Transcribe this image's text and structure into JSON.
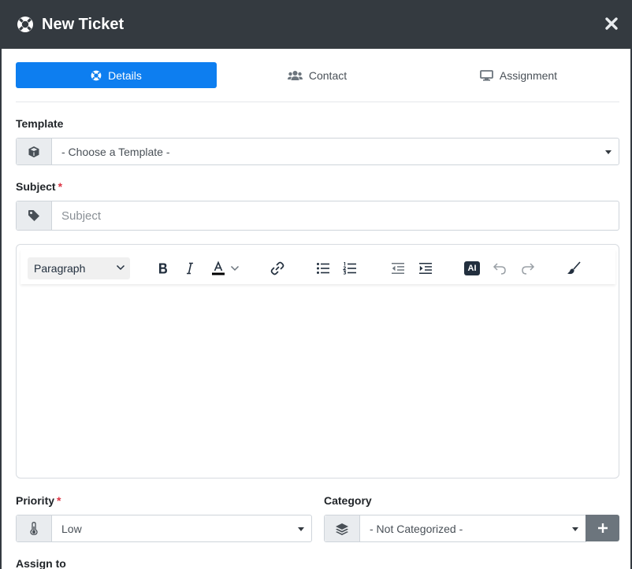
{
  "header": {
    "title": "New Ticket"
  },
  "tabs": [
    {
      "label": "Details",
      "active": true
    },
    {
      "label": "Contact",
      "active": false
    },
    {
      "label": "Assignment",
      "active": false
    }
  ],
  "template": {
    "label": "Template",
    "value": "- Choose a Template -"
  },
  "subject": {
    "label": "Subject",
    "required_mark": "*",
    "placeholder": "Subject"
  },
  "editor": {
    "block_format": "Paragraph",
    "ai_label": "AI"
  },
  "priority": {
    "label": "Priority",
    "required_mark": "*",
    "value": "Low"
  },
  "category": {
    "label": "Category",
    "value": "- Not Categorized -"
  },
  "assign": {
    "label": "Assign to"
  },
  "colors": {
    "header_bg": "#343a40",
    "primary": "#0d7ef0",
    "required": "#dc3545",
    "secondary": "#6c757d"
  }
}
